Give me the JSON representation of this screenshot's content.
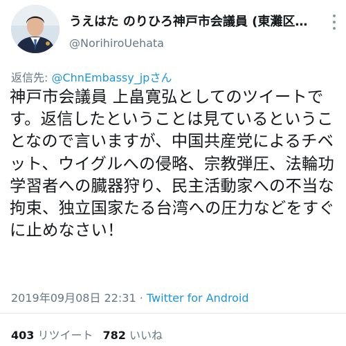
{
  "user": {
    "display_name": "うえはた のりひろ神戸市会議員 (東灘区…",
    "screen_name": "@NorihiroUehata"
  },
  "reply": {
    "prefix": "返信先: ",
    "mention": "@ChnEmbassy_jpさん"
  },
  "tweet": {
    "text": "神戸市会議員 上畠寛弘としてのツイートです。返信したということは見ているということなので言いますが、中国共産党によるチベット、ウイグルへの侵略、宗教弾圧、法輪功学習者への臓器狩り、民主活動家への不当な拘束、独立国家たる台湾への圧力などをすぐに止めなさい！",
    "timestamp": "2019年09月08日 22:31 · ",
    "source": "Twitter for Android"
  },
  "stats": {
    "retweets_count": "403",
    "retweets_label": " リツイート",
    "likes_count": "782",
    "likes_label": " いいね"
  },
  "colors": {
    "link": "#1b95e0",
    "secondary_text": "#657786",
    "primary_text": "#14171a"
  },
  "icons": {
    "more": "more-vertical-icon"
  }
}
